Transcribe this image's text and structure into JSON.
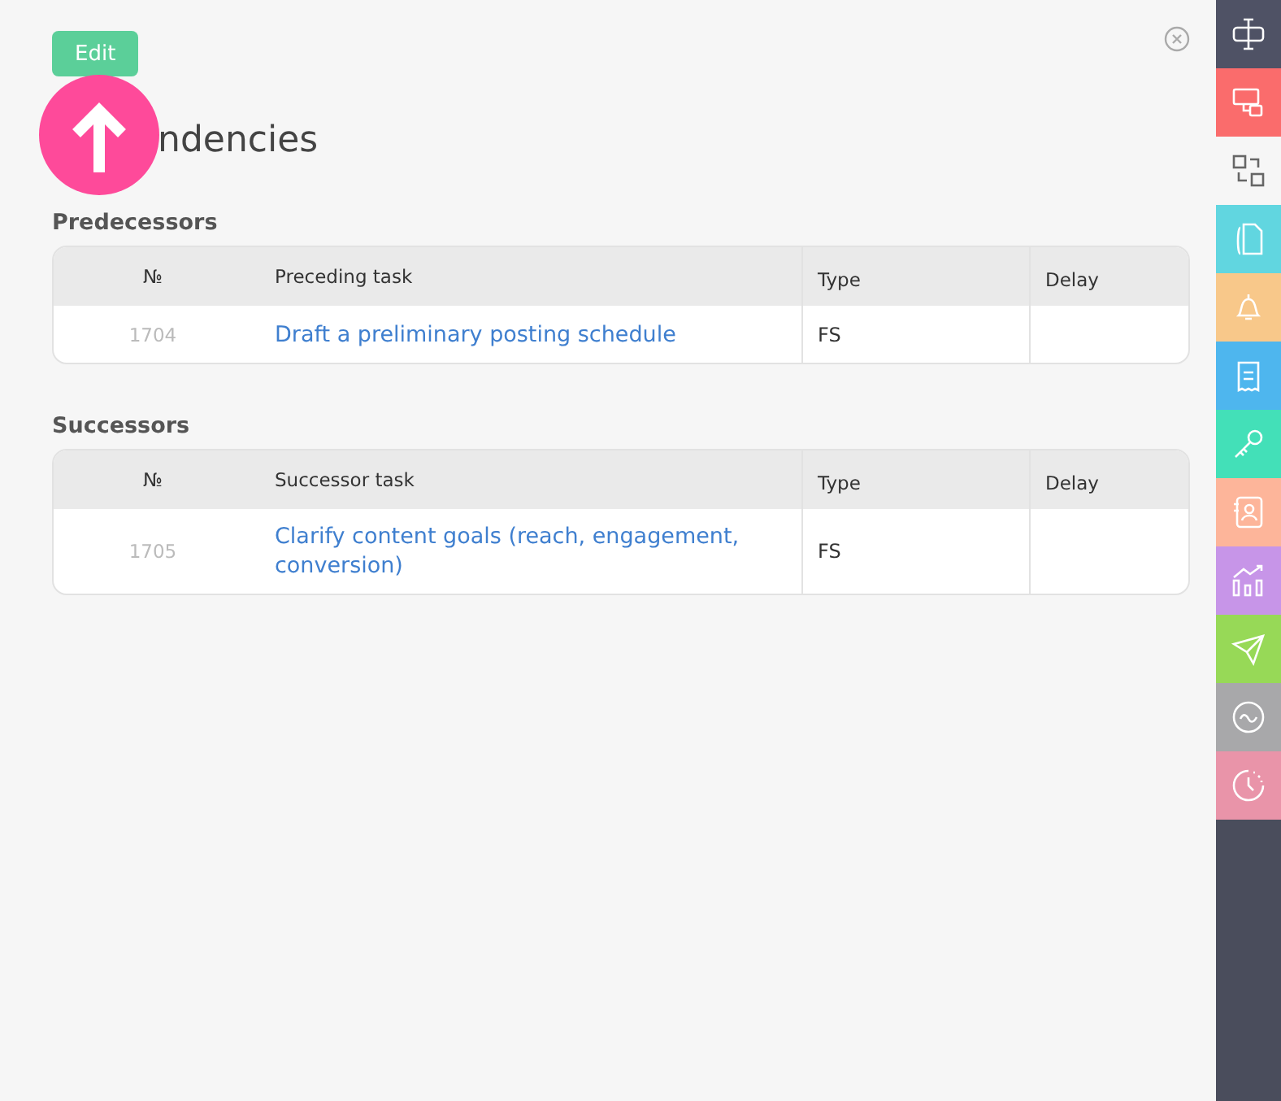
{
  "edit_button": "Edit",
  "title": "ndencies",
  "sections": [
    {
      "heading": "Predecessors",
      "columns": [
        "№",
        "Preceding task",
        "Type",
        "Delay"
      ],
      "rows": [
        {
          "number": "1704",
          "task": "Draft a preliminary posting schedule",
          "type": "FS"
        }
      ]
    },
    {
      "heading": "Successors",
      "columns": [
        "№",
        "Successor task",
        "Type",
        "Delay"
      ],
      "rows": [
        {
          "number": "1705",
          "task": "Clarify content goals (reach, engagement, conversion)",
          "type": "FS"
        }
      ]
    }
  ],
  "sidebar": [
    {
      "kind": "splitter",
      "color": "#4f5265",
      "selected": false
    },
    {
      "kind": "screens",
      "color": "#fa6c6c",
      "selected": false
    },
    {
      "kind": "dependencies",
      "color": "#f6f6f6",
      "selected": true
    },
    {
      "kind": "document",
      "color": "#61d6e0",
      "selected": false
    },
    {
      "kind": "bell",
      "color": "#f8c88a",
      "selected": false
    },
    {
      "kind": "clipboard",
      "color": "#4eb6ee",
      "selected": false
    },
    {
      "kind": "key",
      "color": "#43e0b8",
      "selected": false
    },
    {
      "kind": "contact",
      "color": "#fdb59a",
      "selected": false
    },
    {
      "kind": "chart",
      "color": "#c795e8",
      "selected": false
    },
    {
      "kind": "plane",
      "color": "#97d957",
      "selected": false
    },
    {
      "kind": "wave",
      "color": "#a8a8aa",
      "selected": false
    },
    {
      "kind": "clock",
      "color": "#e994a9",
      "selected": false
    }
  ]
}
